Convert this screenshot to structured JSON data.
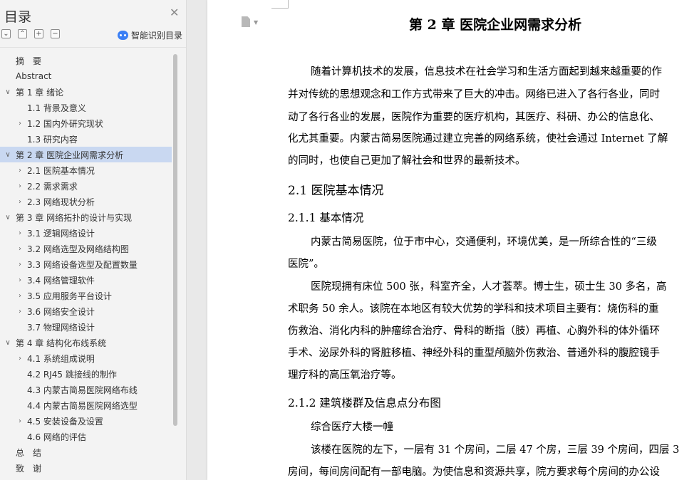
{
  "sidebar": {
    "title": "目录",
    "ai_label": "智能识别目录",
    "tool_icons": [
      "collapse-all-icon",
      "expand-all-icon",
      "add-heading-icon",
      "remove-heading-icon"
    ],
    "items": [
      {
        "label": "摘　要",
        "level": 0,
        "chevron": false
      },
      {
        "label": "Abstract",
        "level": 0,
        "chevron": false
      },
      {
        "label": "第 1 章  绪论",
        "level": 0,
        "chevron": true
      },
      {
        "label": "1.1  背景及意义",
        "level": 1,
        "chevron": false
      },
      {
        "label": "1.2  国内外研究现状",
        "level": 1,
        "chevron": true
      },
      {
        "label": "1.3 研究内容",
        "level": 1,
        "chevron": false
      },
      {
        "label": "第 2 章  医院企业网需求分析",
        "level": 0,
        "chevron": true,
        "selected": true
      },
      {
        "label": "2.1 医院基本情况",
        "level": 1,
        "chevron": true
      },
      {
        "label": "2.2 需求需求",
        "level": 1,
        "chevron": true
      },
      {
        "label": "2.3 网络现状分析",
        "level": 1,
        "chevron": true
      },
      {
        "label": "第 3 章  网络拓扑的设计与实现",
        "level": 0,
        "chevron": true
      },
      {
        "label": "3.1 逻辑网络设计",
        "level": 1,
        "chevron": true
      },
      {
        "label": "3.2 网络选型及网络结构图",
        "level": 1,
        "chevron": true
      },
      {
        "label": "3.3 网络设备选型及配置数量",
        "level": 1,
        "chevron": true
      },
      {
        "label": "3.4 网络管理软件",
        "level": 1,
        "chevron": true
      },
      {
        "label": "3.5 应用服务平台设计",
        "level": 1,
        "chevron": true
      },
      {
        "label": "3.6 网络安全设计",
        "level": 1,
        "chevron": true
      },
      {
        "label": "3.7 物理网络设计",
        "level": 1,
        "chevron": false
      },
      {
        "label": "第 4 章  结构化布线系统",
        "level": 0,
        "chevron": true
      },
      {
        "label": "4.1 系统组成说明",
        "level": 1,
        "chevron": true
      },
      {
        "label": "4.2 RJ45 跳接线的制作",
        "level": 1,
        "chevron": false
      },
      {
        "label": "4.3 内蒙古简易医院网络布线",
        "level": 1,
        "chevron": false
      },
      {
        "label": "4.4 内蒙古简易医院网络选型",
        "level": 1,
        "chevron": false
      },
      {
        "label": "4.5 安装设备及设置",
        "level": 1,
        "chevron": true
      },
      {
        "label": "4.6 网络的评估",
        "level": 1,
        "chevron": false
      },
      {
        "label": "总　结",
        "level": 0,
        "chevron": false
      },
      {
        "label": "致　谢",
        "level": 0,
        "chevron": false
      }
    ]
  },
  "document": {
    "chapter_title": "第 2 章  医院企业网需求分析",
    "intro_lines": [
      "随着计算机技术的发展，信息技术在社会学习和生活方面起到越来越重要的作",
      "并对传统的思想观念和工作方式带来了巨大的冲击。网络已进入了各行各业，同时",
      "动了各行各业的发展，医院作为重要的医疗机构，其医疗、科研、办公的信息化、",
      "化尤其重要。内蒙古简易医院通过建立完善的网络系统，使社会通过 Internet 了解",
      "的同时，也使自己更加了解社会和世界的最新技术。"
    ],
    "h2_1": "2.1 医院基本情况",
    "h3_1": "2.1.1 基本情况",
    "p2_lines": [
      "内蒙古简易医院，位于市中心，交通便利，环境优美，是一所综合性的“三级",
      "医院”。"
    ],
    "p3_lines": [
      "医院现拥有床位 500 张，科室齐全，人才荟萃。博士生，硕士生 30 多名，高",
      "术职务 50 余人。该院在本地区有较大优势的学科和技术项目主要有：烧伤科的重",
      "伤救治、消化内科的肿瘤综合治疗、骨科的断指（肢）再植、心胸外科的体外循环",
      "手术、泌尿外科的肾脏移植、神经外科的重型颅脑外伤救治、普通外科的腹腔镜手",
      "理疗科的高压氧治疗等。"
    ],
    "h3_2": "2.1.2 建筑楼群及信息点分布图",
    "p4": "综合医疗大楼一幢",
    "p5_lines": [
      "该楼在医院的左下，一层有 31 个房间，二层 47 个房，三层 39 个房间，四层 3",
      "房间，每间房间配有一部电脑。为使信息和资源共享，院方要求每个房间的办公设"
    ]
  }
}
